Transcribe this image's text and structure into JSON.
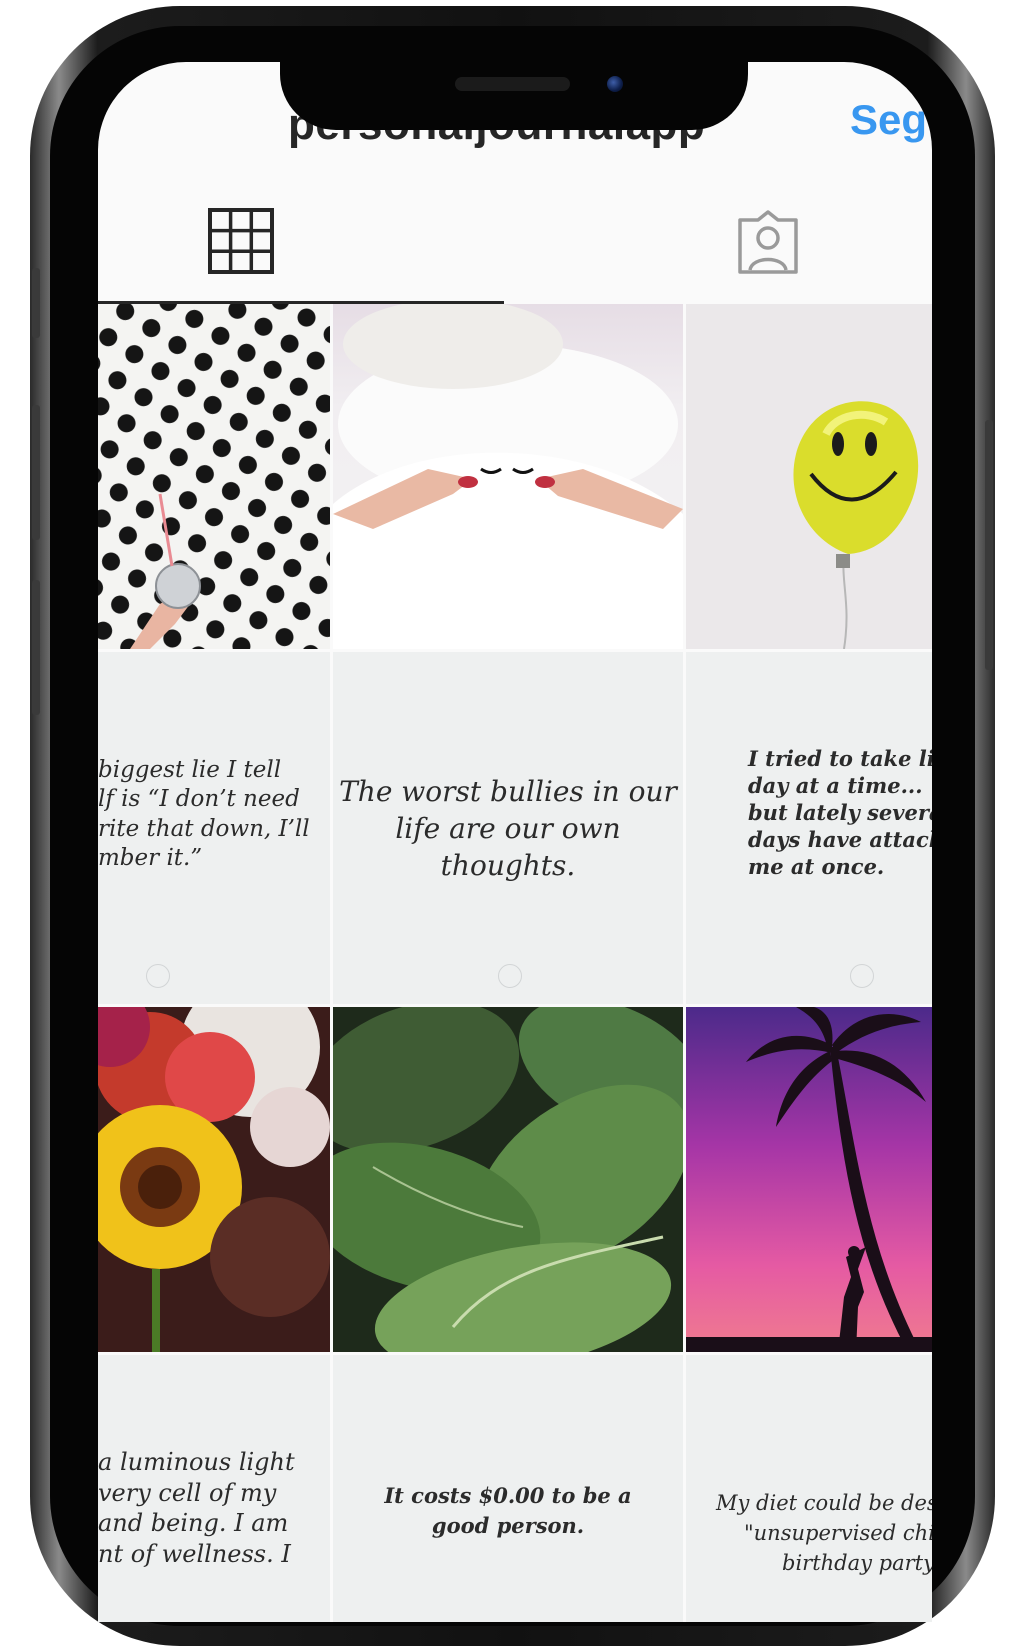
{
  "profile": {
    "username": "personaljournalapp",
    "follow_label": "Seg"
  },
  "tabs": [
    {
      "name": "grid",
      "icon": "grid-icon",
      "active": true
    },
    {
      "name": "tagged",
      "icon": "tagged-person-icon",
      "active": false
    }
  ],
  "posts": [
    {
      "type": "photo",
      "subject": "polka dot wall with disco ball glass"
    },
    {
      "type": "photo",
      "subject": "person under white sheets holding eye lashes"
    },
    {
      "type": "photo",
      "subject": "yellow smiley balloon"
    },
    {
      "type": "quote",
      "text": "The biggest lie I tell myself is “I don’t need to write that down, I’ll remember it.”"
    },
    {
      "type": "quote",
      "text": "The worst bullies in our life are our own thoughts."
    },
    {
      "type": "quote",
      "text": "I tried to take life one day at a time... but lately several days have attacked me at once."
    },
    {
      "type": "photo",
      "subject": "flowers with sunflower"
    },
    {
      "type": "photo",
      "subject": "green leaves"
    },
    {
      "type": "photo",
      "subject": "palm tree at pink sunset"
    },
    {
      "type": "quote",
      "text": "I am a luminous light. Every cell of my body and being. I am a giant of wellness. I"
    },
    {
      "type": "quote",
      "text": "It costs $0.00 to be a good person."
    },
    {
      "type": "quote",
      "text": "My diet could be described as \"unsupervised child at a birthday party\""
    }
  ],
  "visible_quote_lines": {
    "q1": [
      "biggest lie I tell",
      "lf is “I don’t need",
      "rite that down, I’ll",
      "mber it.”"
    ],
    "q2": [
      "The worst bullies in our",
      "life are our own",
      "thoughts."
    ],
    "q3": [
      "I tried to take life",
      "day at a time...",
      "but lately several",
      "days have attacke",
      "me at once."
    ],
    "q4": [
      "a luminous light",
      "very cell of my",
      "and being. I am",
      "nt of wellness. I"
    ],
    "q5": [
      "It costs $0.00 to be a",
      "good person."
    ],
    "q6": [
      "My diet could be descr",
      "\"unsupervised child",
      "birthday party\""
    ]
  },
  "colors": {
    "accent": "#3897f0",
    "text": "#262626",
    "quote_bg": "#eef0f0"
  }
}
